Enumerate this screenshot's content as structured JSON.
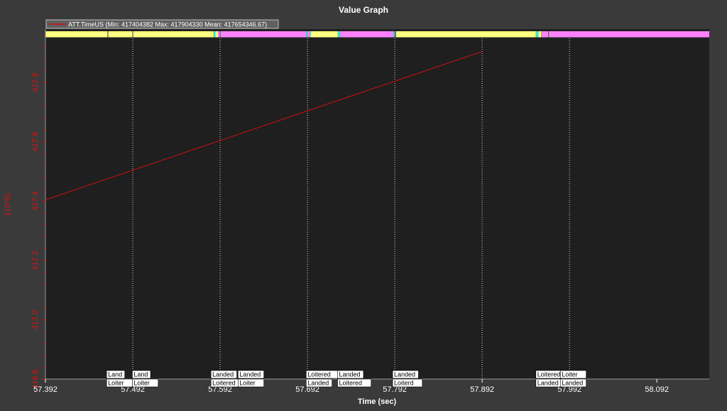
{
  "chart_data": {
    "type": "line",
    "title": "Value Graph",
    "xlabel": "Time (sec)",
    "ylabel": "(10^6)",
    "xlim": [
      57.392,
      58.152
    ],
    "ylim": [
      416.8,
      417.98
    ],
    "x_ticks": [
      "57.392",
      "57.492",
      "57.592",
      "57.692",
      "57.792",
      "57.892",
      "57.992",
      "58.092"
    ],
    "y_ticks": [
      "416.8",
      "417.0",
      "417.2",
      "417.4",
      "417.6",
      "417.8"
    ],
    "series": [
      {
        "name": "ATT.TimeUS",
        "legend_text": "ATT.TimeUS  (Min: 417404382 Max: 417904330 Mean: 417654346.67)",
        "color": "#cc1010",
        "x": [
          57.392,
          57.8918
        ],
        "y": [
          417.404382,
          417.90433
        ]
      }
    ],
    "mode_bar": [
      {
        "from": 57.392,
        "to": 57.463,
        "color": "#ffff80"
      },
      {
        "from": 57.463,
        "to": 57.464,
        "color": "#707070"
      },
      {
        "from": 57.464,
        "to": 57.4915,
        "color": "#ffff80"
      },
      {
        "from": 57.4915,
        "to": 57.4925,
        "color": "#707070"
      },
      {
        "from": 57.4925,
        "to": 57.5815,
        "color": "#ffff80"
      },
      {
        "from": 57.5815,
        "to": 57.5845,
        "color": "#ffff80"
      },
      {
        "from": 57.5845,
        "to": 57.5865,
        "color": "#40e0d0"
      },
      {
        "from": 57.5865,
        "to": 57.5895,
        "color": "#ffff80"
      },
      {
        "from": 57.5895,
        "to": 57.5915,
        "color": "#ff80ff"
      },
      {
        "from": 57.5915,
        "to": 57.5925,
        "color": "#707070"
      },
      {
        "from": 57.5925,
        "to": 57.6905,
        "color": "#ff80ff"
      },
      {
        "from": 57.6905,
        "to": 57.6925,
        "color": "#40e0d0"
      },
      {
        "from": 57.6925,
        "to": 57.6945,
        "color": "#ff80ff"
      },
      {
        "from": 57.6945,
        "to": 57.6955,
        "color": "#40e0d0"
      },
      {
        "from": 57.6955,
        "to": 57.7265,
        "color": "#ffff80"
      },
      {
        "from": 57.7265,
        "to": 57.7295,
        "color": "#40e0d0"
      },
      {
        "from": 57.7295,
        "to": 57.7895,
        "color": "#ff80ff"
      },
      {
        "from": 57.7895,
        "to": 57.7915,
        "color": "#40e0d0"
      },
      {
        "from": 57.7915,
        "to": 57.7935,
        "color": "#707070"
      },
      {
        "from": 57.7935,
        "to": 57.9535,
        "color": "#ffff80"
      },
      {
        "from": 57.9535,
        "to": 57.9565,
        "color": "#40e0d0"
      },
      {
        "from": 57.9565,
        "to": 57.9595,
        "color": "#ffff80"
      },
      {
        "from": 57.9595,
        "to": 57.9675,
        "color": "#ff80ff"
      },
      {
        "from": 57.9675,
        "to": 57.9685,
        "color": "#707070"
      },
      {
        "from": 57.9685,
        "to": 58.152,
        "color": "#ff80ff"
      }
    ],
    "event_lines": [
      57.492,
      57.592,
      57.692,
      57.792,
      57.892,
      57.992
    ],
    "event_labels": [
      {
        "x": 57.462,
        "top": "Land",
        "bottom": "Loiter"
      },
      {
        "x": 57.4915,
        "top": "Land",
        "bottom": "Loiter"
      },
      {
        "x": 57.5815,
        "top": "Landed",
        "bottom": "Loitered"
      },
      {
        "x": 57.6125,
        "top": "Landed",
        "bottom": "Loiter"
      },
      {
        "x": 57.6905,
        "top": "Loitered",
        "bottom": "Landed"
      },
      {
        "x": 57.7265,
        "top": "Landed",
        "bottom": "Loitered"
      },
      {
        "x": 57.7895,
        "top": "Landed",
        "bottom": "Loiterd"
      },
      {
        "x": 57.9535,
        "top": "Loitered",
        "bottom": "Landed"
      },
      {
        "x": 57.9815,
        "top": "Loiter",
        "bottom": "Landed"
      }
    ]
  }
}
